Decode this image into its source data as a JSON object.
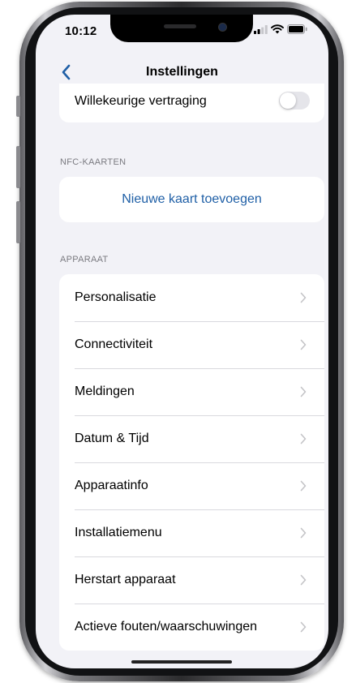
{
  "status_bar": {
    "time": "10:12"
  },
  "nav": {
    "title": "Instellingen"
  },
  "random_delay": {
    "label": "Willekeurige vertraging",
    "enabled": false
  },
  "nfc_section": {
    "header": "NFC-KAARTEN",
    "add_card_label": "Nieuwe kaart toevoegen"
  },
  "device_section": {
    "header": "APPARAAT",
    "items": [
      {
        "label": "Personalisatie"
      },
      {
        "label": "Connectiviteit"
      },
      {
        "label": "Meldingen"
      },
      {
        "label": "Datum & Tijd"
      },
      {
        "label": "Apparaatinfo"
      },
      {
        "label": "Installatiemenu"
      },
      {
        "label": "Herstart apparaat"
      },
      {
        "label": "Actieve fouten/waarschuwingen"
      }
    ]
  },
  "colors": {
    "accent": "#1f5fa6",
    "background": "#f2f2f7",
    "chevron": "#c4c4c7"
  }
}
